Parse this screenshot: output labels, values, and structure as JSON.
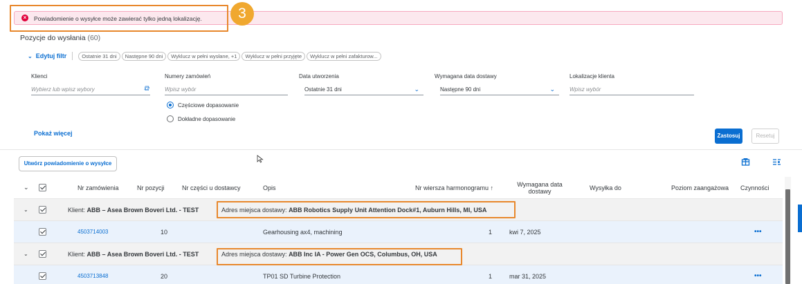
{
  "message": {
    "text": "Powiadomienie o wysyłce może zawierać tylko jedną lokalizację.",
    "icon": "error-circle-icon",
    "step_number": "3"
  },
  "section": {
    "title": "Pozycje do wysłania",
    "count": "(60)"
  },
  "filterbar": {
    "edit_label": "Edytuj filtr",
    "chips": [
      "Ostatnie 31 dni",
      "Następne 90 dni",
      "Wyklucz w pełni wysłane, +1",
      "Wyklucz w pełni przyjęte",
      "Wyklucz w pełni zafakturow..."
    ]
  },
  "filters": {
    "clients_label": "Klienci",
    "clients_placeholder": "Wybierz lub wpisz wybory",
    "orders_label": "Numery zamówień",
    "orders_placeholder": "Wpisz wybór",
    "match_partial": "Częściowe dopasowanie",
    "match_exact": "Dokładne dopasowanie",
    "created_label": "Data utworzenia",
    "created_value": "Ostatnie 31 dni",
    "delivery_label": "Wymagana data dostawy",
    "delivery_value": "Następne 90 dni",
    "location_label": "Lokalizacje klienta",
    "location_placeholder": "Wpisz wybór",
    "show_more": "Pokaż więcej",
    "apply": "Zastosuj",
    "reset": "Resetuj"
  },
  "toolbar": {
    "create_label": "Utwórz powiadomienie o wysyłce",
    "icons": [
      "table-view-icon",
      "column-settings-icon"
    ]
  },
  "table": {
    "headers": {
      "order_no": "Nr zamówienia",
      "item_no": "Nr pozycji",
      "supplier_part": "Nr części u dostawcy",
      "description": "Opis",
      "schedule_line": "Nr wiersza harmonogramu ↑",
      "required_date": "Wymagana data dostawy",
      "ship_to": "Wysyłka do",
      "commitment": "Poziom zaangażowa",
      "actions": "Czynności"
    },
    "groups": [
      {
        "client_prefix": "Klient: ",
        "client_name": "ABB – Asea Brown Boveri Ltd. - TEST",
        "address_prefix": "Adres miejsca dostawy: ",
        "address_value": "ABB Robotics Supply Unit Attention Dock#1, Auburn Hills, MI, USA",
        "item": {
          "order_no": "4503714003",
          "item_no": "10",
          "description": "Gearhousing ax4, machining",
          "schedule_line": "1",
          "required_date": "kwi 7, 2025",
          "actions": "•••"
        }
      },
      {
        "client_prefix": "Klient: ",
        "client_name": "ABB – Asea Brown Boveri Ltd. - TEST",
        "address_prefix": "Adres miejsca dostawy: ",
        "address_value": "ABB Inc IA - Power Gen OCS, Columbus, OH, USA",
        "item": {
          "order_no": "4503713848",
          "item_no": "20",
          "description": "TP01 SD Turbine Protection",
          "schedule_line": "1",
          "required_date": "mar 31, 2025",
          "actions": "•••"
        }
      }
    ]
  },
  "colors": {
    "accent": "#0a6ed1",
    "error": "#e0003b",
    "highlight": "#e8872b",
    "badge": "#f0a82f"
  }
}
